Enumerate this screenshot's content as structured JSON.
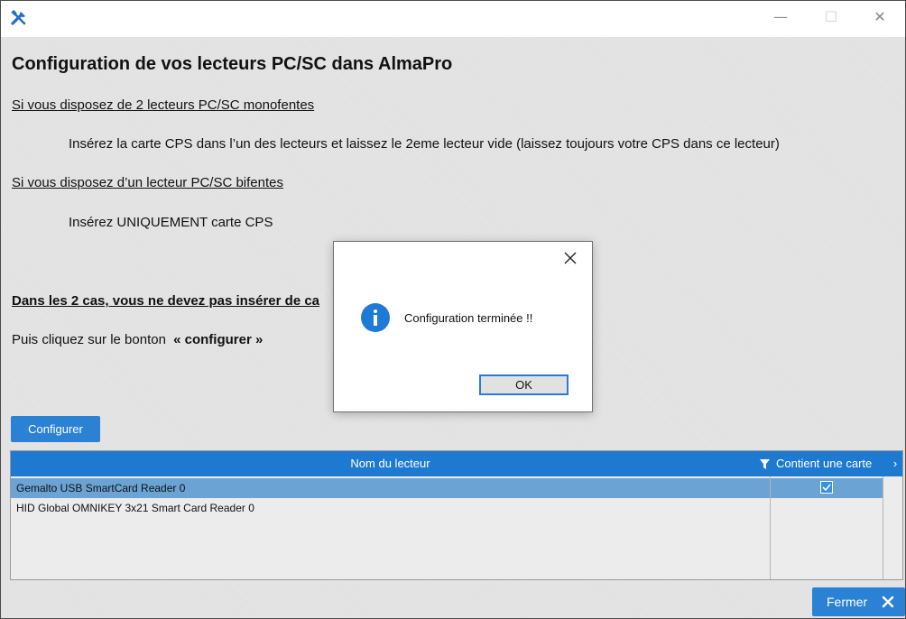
{
  "window": {
    "controls": {
      "minimize": "—",
      "maximize": "☐",
      "close": "✕"
    }
  },
  "main": {
    "title": "Configuration de vos lecteurs PC/SC dans AlmaPro",
    "section1_heading": "Si vous disposez de 2 lecteurs PC/SC monofentes",
    "section1_text": "Insérez la carte CPS dans l’un des lecteurs et laissez le 2eme lecteur vide (laissez toujours votre CPS dans ce lecteur)",
    "section2_heading": "Si vous disposez d’un lecteur PC/SC bifentes",
    "section2_text": "Insérez UNIQUEMENT carte CPS",
    "warning": "Dans les 2 cas, vous ne devez pas insérer de ca",
    "instruction_prefix": "Puis cliquez sur le bonton ",
    "instruction_bold": "« configurer »",
    "configure_button": "Configurer"
  },
  "table": {
    "headers": {
      "name": "Nom du lecteur",
      "contains_card": "Contient une carte",
      "scroll": "›"
    },
    "rows": [
      {
        "name": "Gemalto USB SmartCard Reader 0",
        "contains_card": true,
        "selected": true
      },
      {
        "name": "HID Global OMNIKEY 3x21 Smart Card Reader 0",
        "contains_card": false,
        "selected": false
      }
    ]
  },
  "footer": {
    "close_button": "Fermer"
  },
  "dialog": {
    "message": "Configuration terminée !!",
    "ok_button": "OK"
  },
  "colors": {
    "accent": "#2b82d4",
    "header": "#1e7ad1",
    "selected_row": "#6aa3d4",
    "info_icon": "#1f7ad6"
  },
  "icons": [
    "app-tools-icon",
    "filter-icon",
    "info-icon",
    "close-icon",
    "check-icon"
  ]
}
